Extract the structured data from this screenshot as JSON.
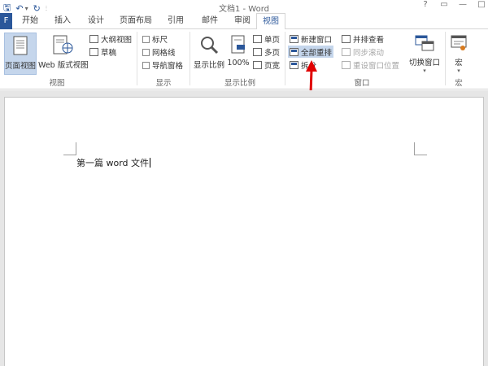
{
  "titlebar": {
    "title": "文档1 - Word",
    "qat": {
      "save": "🖫",
      "undo": "↶",
      "undo_arrow": "▾",
      "redo": "↻",
      "customize": "⫶"
    },
    "controls": {
      "help": "?",
      "restore": "▭",
      "minimize": "—",
      "close": "□"
    }
  },
  "tabs": {
    "file": "F",
    "items": [
      "开始",
      "插入",
      "设计",
      "页面布局",
      "引用",
      "邮件",
      "审阅",
      "视图"
    ],
    "active": "视图"
  },
  "ribbon": {
    "views": {
      "label": "视图",
      "print_layout": "页面视图",
      "web_layout": "Web 版式视图",
      "outline": "大纲视图",
      "draft": "草稿"
    },
    "show": {
      "label": "显示",
      "ruler": "标尺",
      "gridlines": "网格线",
      "nav_pane": "导航窗格"
    },
    "zoom": {
      "label": "显示比例",
      "zoom": "显示比例",
      "hundred": "100%",
      "one_page": "单页",
      "multi_page": "多页",
      "page_width": "页宽"
    },
    "window": {
      "label": "窗口",
      "new_window": "新建窗口",
      "arrange_all": "全部重排",
      "split": "拆分",
      "side_by_side": "并排查看",
      "sync_scroll": "同步滚动",
      "reset_position": "重设窗口位置",
      "switch_windows": "切换窗口",
      "switch_arrow": "▾"
    },
    "macros": {
      "label": "宏",
      "macros": "宏",
      "macros_arrow": "▾"
    }
  },
  "document": {
    "text": "第一篇 word 文件"
  },
  "colors": {
    "accent": "#2b579a",
    "arrow": "#e00000",
    "selected": "#c5d6ec"
  }
}
